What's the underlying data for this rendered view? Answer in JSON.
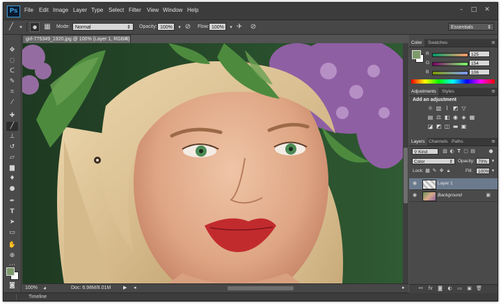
{
  "app": {
    "logo_text": "Ps"
  },
  "menu": [
    "File",
    "Edit",
    "Image",
    "Layer",
    "Type",
    "Select",
    "Filter",
    "View",
    "Window",
    "Help"
  ],
  "options": {
    "mode_label": "Mode:",
    "mode_value": "Normal",
    "opacity_label": "Opacity:",
    "opacity_value": "100%",
    "flow_label": "Flow:",
    "flow_value": "100%",
    "workspace": "Essentials"
  },
  "document": {
    "tab_title": "girl-775349_1920.jpg @ 100% (Layer 1, RGB/8) *",
    "close_glyph": "×"
  },
  "status": {
    "zoom": "100%",
    "doc_size": "Doc: 6.98M/8.01M"
  },
  "timeline": {
    "label": "Timeline"
  },
  "color_panel": {
    "tabs": [
      "Color",
      "Swatches"
    ],
    "channels": [
      {
        "label": "R",
        "value": "125"
      },
      {
        "label": "G",
        "value": "154"
      },
      {
        "label": "B",
        "value": "106"
      }
    ],
    "foreground": "#7d9a6a",
    "background_color": "#ffffff"
  },
  "adjustments_panel": {
    "tabs": [
      "Adjustments",
      "Styles"
    ],
    "title": "Add an adjustment"
  },
  "layers_panel": {
    "tabs": [
      "Layers",
      "Channels",
      "Paths"
    ],
    "filter_value": "Kind",
    "blend_value": "Color",
    "opacity_label": "Opacity:",
    "opacity_value": "70%",
    "lock_label": "Lock:",
    "fill_label": "Fill:",
    "fill_value": "100%",
    "layers": [
      {
        "name": "Layer 1",
        "selected": true
      },
      {
        "name": "Background",
        "selected": false
      }
    ]
  }
}
